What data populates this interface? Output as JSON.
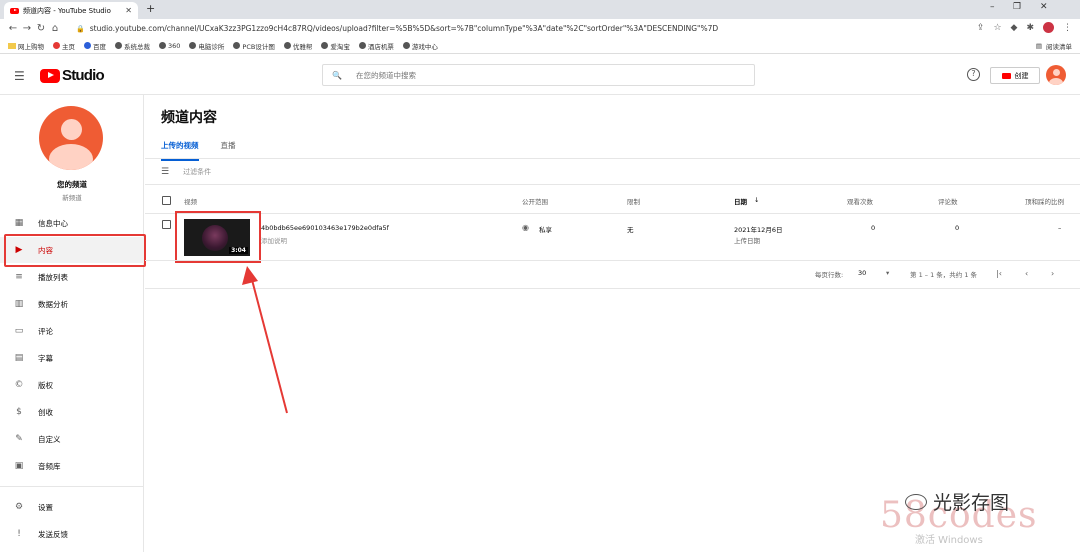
{
  "browser": {
    "tab_title": "频道内容 - YouTube Studio",
    "new_tab": "+",
    "url": "studio.youtube.com/channel/UCxaK3zz3PG1zzo9cH4c87RQ/videos/upload?filter=%5B%5D&sort=%7B\"columnType\"%3A\"date\"%2C\"sortOrder\"%3A\"DESCENDING\"%7D",
    "bookmarks": [
      "网上购物",
      "主页",
      "百度",
      "系统总裁",
      "360",
      "电脑诊所",
      "PCB设计图",
      "优雅帮",
      "爱淘宝",
      "酒店机票",
      "游戏中心"
    ],
    "reading_list": "阅读清单"
  },
  "header": {
    "logo_text": "Studio",
    "search_placeholder": "在您的频道中搜索",
    "create_label": "创建"
  },
  "sidebar": {
    "channel_name": "您的频道",
    "channel_sub": "新频道",
    "items": [
      {
        "label": "信息中心",
        "icon": "dashboard-icon"
      },
      {
        "label": "内容",
        "icon": "content-icon",
        "active": true
      },
      {
        "label": "播放列表",
        "icon": "playlist-icon"
      },
      {
        "label": "数据分析",
        "icon": "analytics-icon"
      },
      {
        "label": "评论",
        "icon": "comments-icon"
      },
      {
        "label": "字幕",
        "icon": "subtitles-icon"
      },
      {
        "label": "版权",
        "icon": "copyright-icon"
      },
      {
        "label": "创收",
        "icon": "monetization-icon"
      },
      {
        "label": "自定义",
        "icon": "customization-icon"
      },
      {
        "label": "音频库",
        "icon": "audio-library-icon"
      }
    ],
    "bottom_items": [
      {
        "label": "设置",
        "icon": "settings-icon"
      },
      {
        "label": "发送反馈",
        "icon": "feedback-icon"
      }
    ]
  },
  "main": {
    "title": "频道内容",
    "tabs": [
      "上传的视频",
      "直播"
    ],
    "filter_placeholder": "过滤条件",
    "columns": {
      "video": "视频",
      "visibility": "公开范围",
      "restrictions": "限制",
      "date": "日期",
      "views": "观看次数",
      "comments": "评论数",
      "likes": "顶和踩的比例"
    },
    "row": {
      "title": "4b0bdb65ee690103463e179b2e0dfa5f",
      "description": "添加说明",
      "duration": "3:04",
      "visibility": "私享",
      "restrictions": "无",
      "date": "2021年12月6日",
      "date_sub": "上传日期",
      "views": "0",
      "comments": "0",
      "likes": "–"
    },
    "pagination": {
      "rows_label": "每页行数:",
      "rows_value": "30",
      "range": "第 1 – 1 条，共约 1 条"
    }
  },
  "overlay": {
    "brand": "光影存图",
    "watermark_58": "58codes",
    "windows_text": "激活 Windows"
  }
}
